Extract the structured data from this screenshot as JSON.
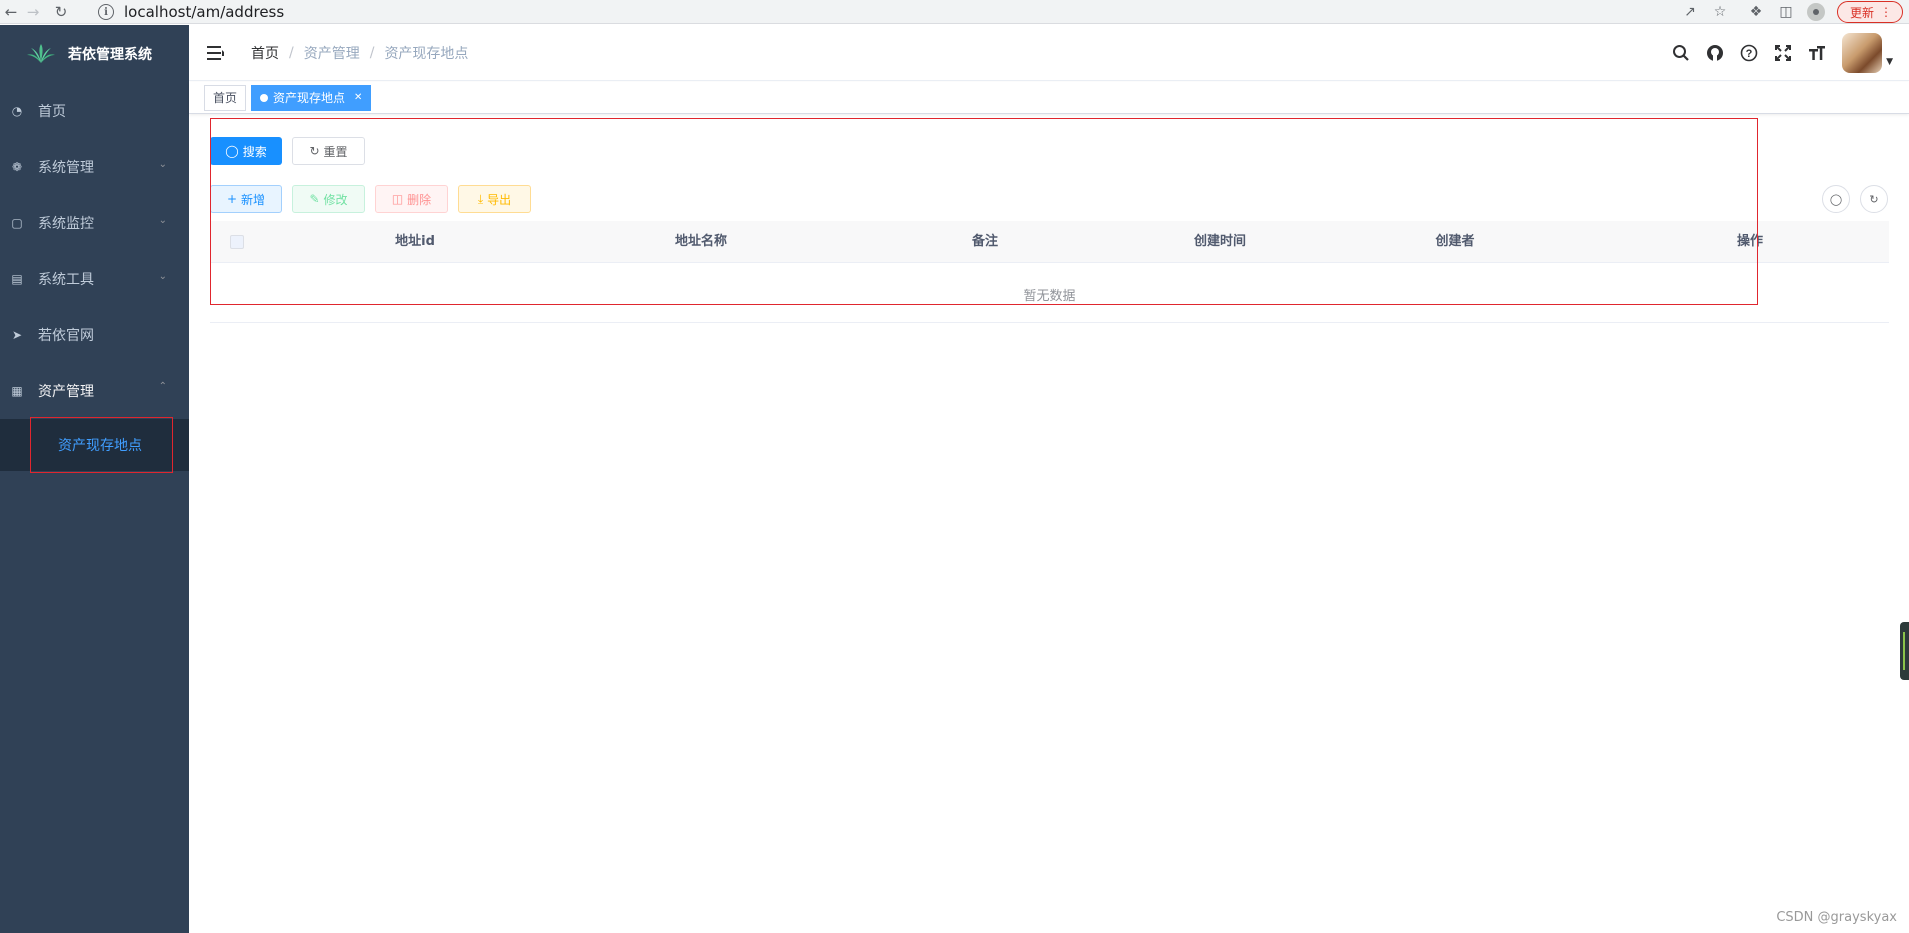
{
  "browser": {
    "url": "localhost/am/address",
    "update_label": "更新"
  },
  "sidebar": {
    "logo_text": "若依管理系统",
    "items": [
      {
        "label": "首页",
        "icon": "dashboard-icon"
      },
      {
        "label": "系统管理",
        "icon": "gear-icon"
      },
      {
        "label": "系统监控",
        "icon": "monitor-icon"
      },
      {
        "label": "系统工具",
        "icon": "toolbox-icon"
      },
      {
        "label": "若依官网",
        "icon": "paper-plane-icon"
      },
      {
        "label": "资产管理",
        "icon": "table-icon"
      }
    ],
    "submenu": {
      "label": "资产现存地点"
    }
  },
  "navbar": {
    "breadcrumb": [
      "首页",
      "资产管理",
      "资产现存地点"
    ]
  },
  "tags": {
    "home": "首页",
    "active": "资产现存地点"
  },
  "toolbar": {
    "search_label": "搜索",
    "reset_label": "重置",
    "add_label": "新增",
    "edit_label": "修改",
    "delete_label": "删除",
    "export_label": "导出"
  },
  "table": {
    "columns": [
      "地址id",
      "地址名称",
      "备注",
      "创建时间",
      "创建者",
      "操作"
    ],
    "empty_text": "暂无数据"
  },
  "watermark": "CSDN @grayskyax",
  "colors": {
    "sidebar_bg": "#304156",
    "primary": "#1890ff",
    "highlight_box": "#e0262e"
  }
}
